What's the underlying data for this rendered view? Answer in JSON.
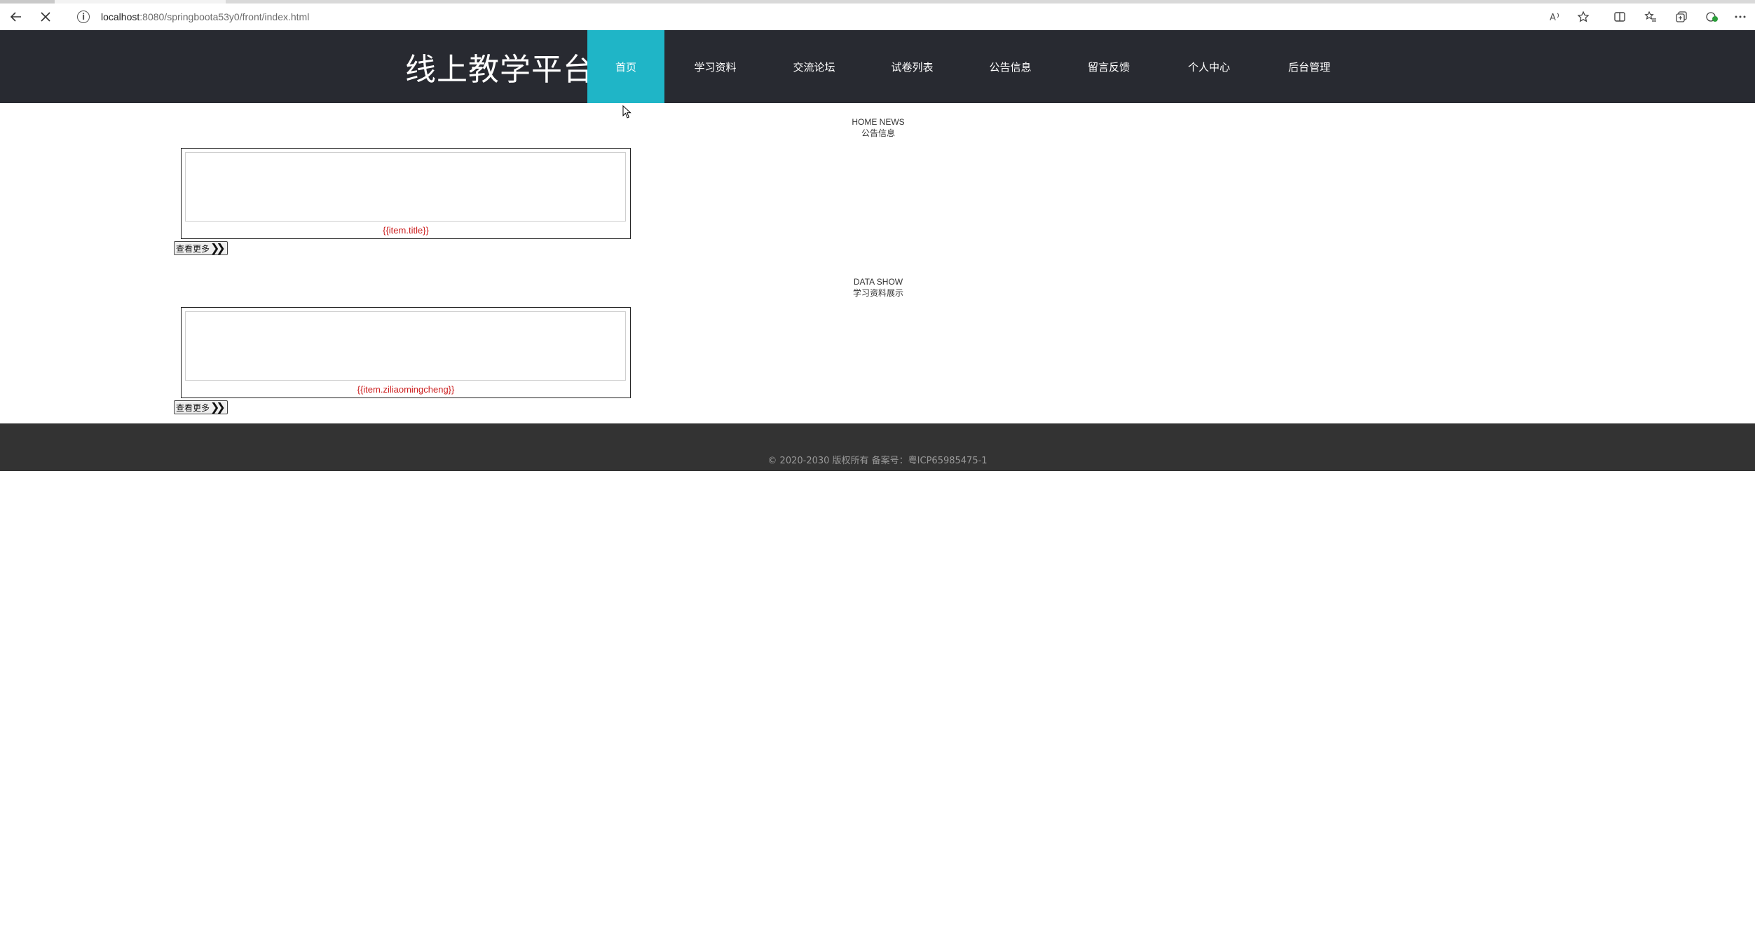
{
  "browser": {
    "url_host": "localhost",
    "url_path": ":8080/springboota53y0/front/index.html",
    "icons": [
      "back-arrow-icon",
      "stop-loading-icon",
      "site-info-icon",
      "read-aloud-icon",
      "favorite-star-icon",
      "split-screen-icon",
      "favorites-icon",
      "collections-icon",
      "extensions-icon",
      "more-menu-icon"
    ]
  },
  "header": {
    "logo": "线上教学平台",
    "nav": [
      {
        "label": "首页",
        "active": true
      },
      {
        "label": "学习资料",
        "active": false
      },
      {
        "label": "交流论坛",
        "active": false
      },
      {
        "label": "试卷列表",
        "active": false
      },
      {
        "label": "公告信息",
        "active": false
      },
      {
        "label": "留言反馈",
        "active": false
      },
      {
        "label": "个人中心",
        "active": false
      },
      {
        "label": "后台管理",
        "active": false
      }
    ]
  },
  "news": {
    "title_en": "HOME NEWS",
    "title_zh": "公告信息",
    "item_caption": "{{item.title}}",
    "more_label": "查看更多"
  },
  "data_show": {
    "title_en": "DATA SHOW",
    "title_zh": "学习资料展示",
    "item_caption": "{{item.ziliaomingcheng}}",
    "more_label": "查看更多"
  },
  "footer": {
    "text": "© 2020-2030 版权所有 备案号：粤ICP65985475-1"
  },
  "colors": {
    "header_bg": "#282a31",
    "nav_active": "#1fb5c7",
    "caption_red": "#cc1f1f",
    "footer_bg": "#333333"
  }
}
